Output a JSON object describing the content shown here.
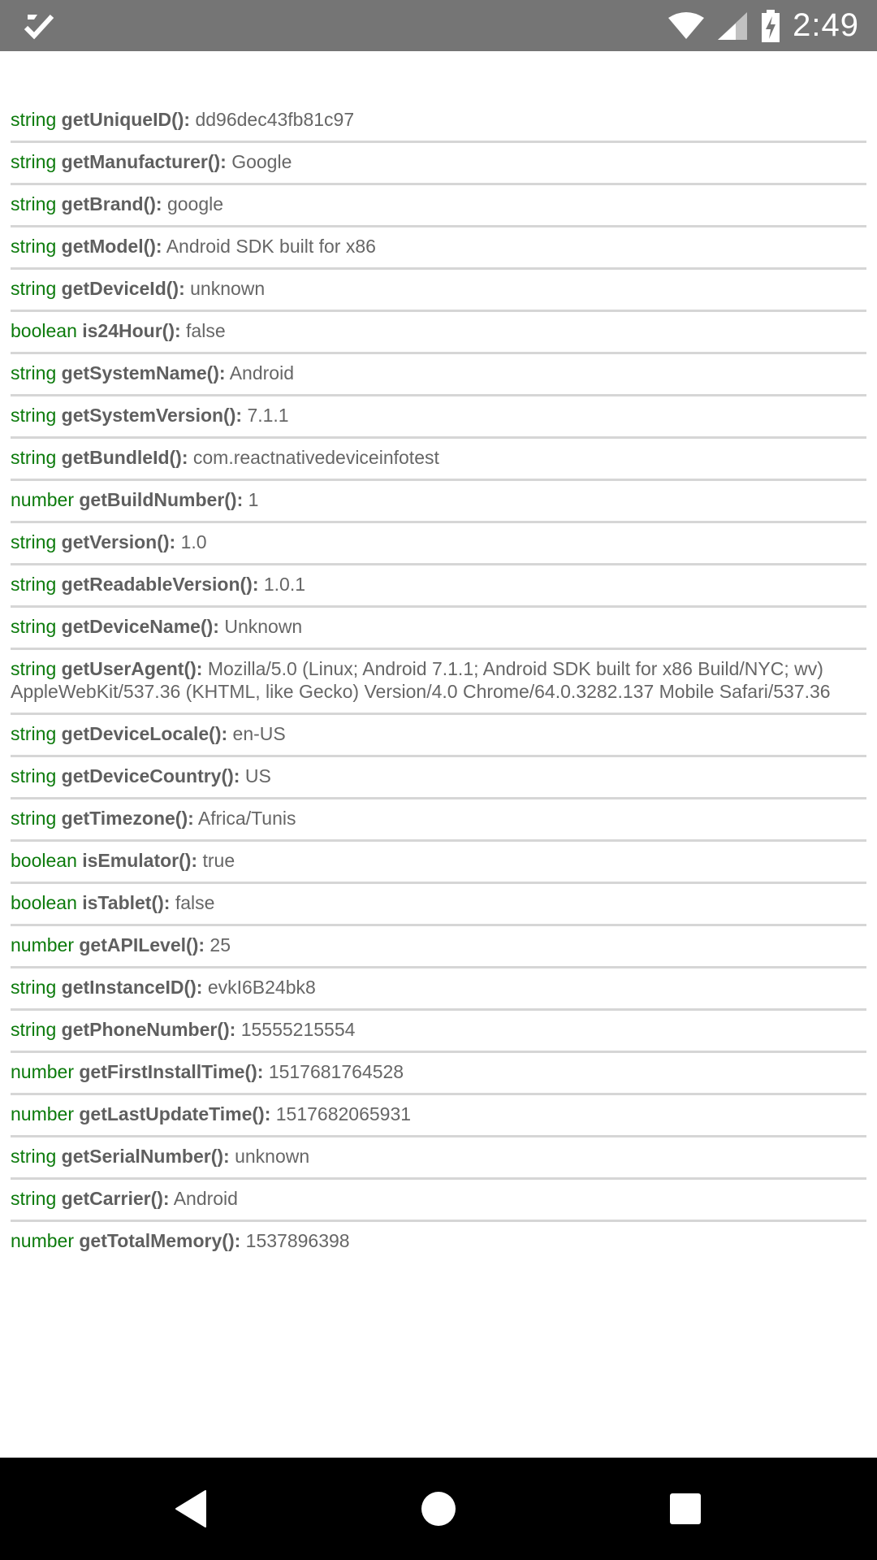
{
  "status_bar": {
    "time": "2:49",
    "icons": [
      "checkmark-notification-icon",
      "wifi-icon",
      "cell-signal-icon",
      "battery-charging-icon"
    ]
  },
  "rows": [
    {
      "type": "string",
      "method": "getUniqueID():",
      "value": "dd96dec43fb81c97"
    },
    {
      "type": "string",
      "method": "getManufacturer():",
      "value": "Google"
    },
    {
      "type": "string",
      "method": "getBrand():",
      "value": "google"
    },
    {
      "type": "string",
      "method": "getModel():",
      "value": "Android SDK built for x86"
    },
    {
      "type": "string",
      "method": "getDeviceId():",
      "value": "unknown"
    },
    {
      "type": "boolean",
      "method": "is24Hour():",
      "value": "false"
    },
    {
      "type": "string",
      "method": "getSystemName():",
      "value": "Android"
    },
    {
      "type": "string",
      "method": "getSystemVersion():",
      "value": "7.1.1"
    },
    {
      "type": "string",
      "method": "getBundleId():",
      "value": "com.reactnativedeviceinfotest"
    },
    {
      "type": "number",
      "method": "getBuildNumber():",
      "value": "1"
    },
    {
      "type": "string",
      "method": "getVersion():",
      "value": "1.0"
    },
    {
      "type": "string",
      "method": "getReadableVersion():",
      "value": "1.0.1"
    },
    {
      "type": "string",
      "method": "getDeviceName():",
      "value": "Unknown"
    },
    {
      "type": "string",
      "method": "getUserAgent():",
      "value": "Mozilla/5.0 (Linux; Android 7.1.1; Android SDK built for x86 Build/NYC; wv) AppleWebKit/537.36 (KHTML, like Gecko) Version/4.0 Chrome/64.0.3282.137 Mobile Safari/537.36"
    },
    {
      "type": "string",
      "method": "getDeviceLocale():",
      "value": "en-US"
    },
    {
      "type": "string",
      "method": "getDeviceCountry():",
      "value": "US"
    },
    {
      "type": "string",
      "method": "getTimezone():",
      "value": "Africa/Tunis"
    },
    {
      "type": "boolean",
      "method": "isEmulator():",
      "value": "true"
    },
    {
      "type": "boolean",
      "method": "isTablet():",
      "value": "false"
    },
    {
      "type": "number",
      "method": "getAPILevel():",
      "value": "25"
    },
    {
      "type": "string",
      "method": "getInstanceID():",
      "value": "evkI6B24bk8"
    },
    {
      "type": "string",
      "method": "getPhoneNumber():",
      "value": "15555215554"
    },
    {
      "type": "number",
      "method": "getFirstInstallTime():",
      "value": "1517681764528"
    },
    {
      "type": "number",
      "method": "getLastUpdateTime():",
      "value": "1517682065931"
    },
    {
      "type": "string",
      "method": "getSerialNumber():",
      "value": "unknown"
    },
    {
      "type": "string",
      "method": "getCarrier():",
      "value": "Android"
    },
    {
      "type": "number",
      "method": "getTotalMemory():",
      "value": "1537896398"
    }
  ],
  "nav_bar": {
    "back_icon": "back-triangle-icon",
    "home_icon": "home-circle-icon",
    "recents_icon": "recents-square-icon"
  }
}
